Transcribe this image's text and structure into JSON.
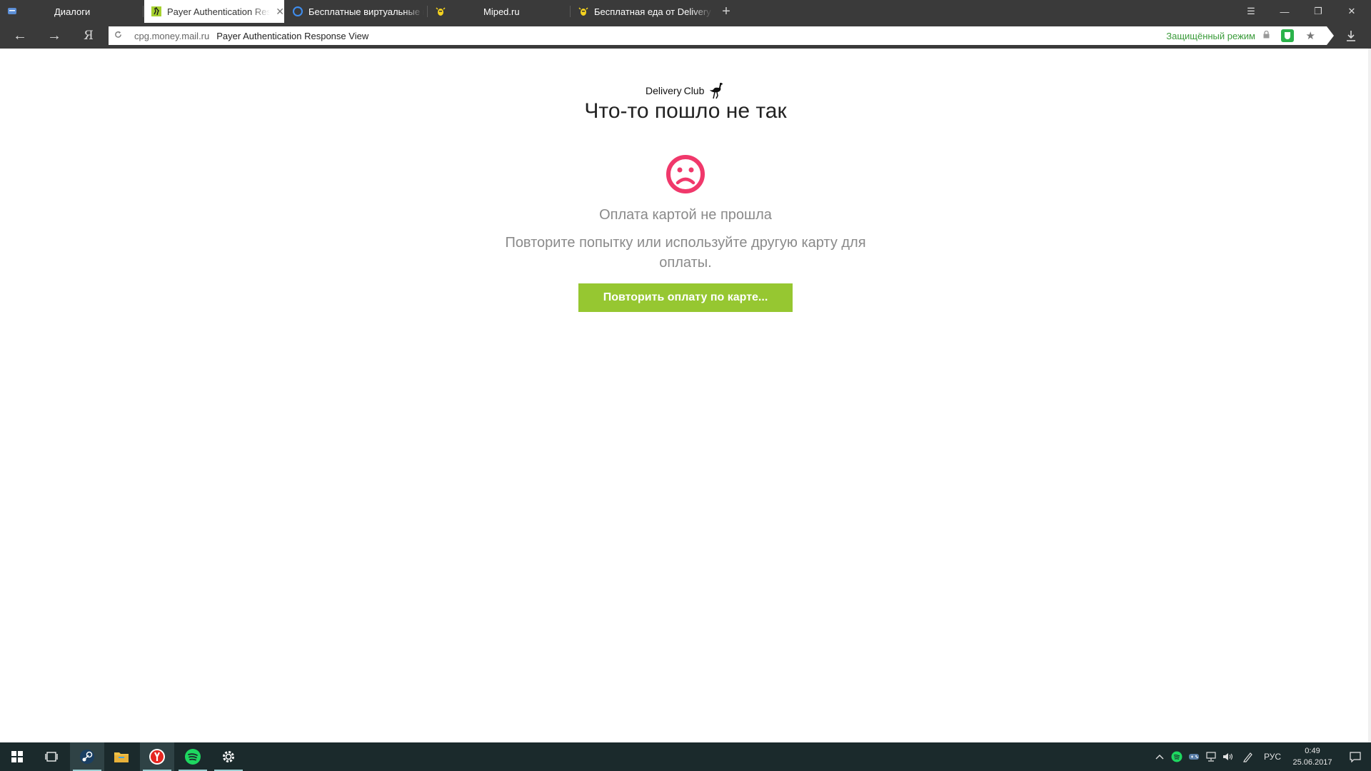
{
  "browser": {
    "tabs": [
      {
        "title": "Диалоги",
        "icon": "vk-message-icon",
        "active": false
      },
      {
        "title": "Payer Authentication Resp",
        "icon": "delivery-club-ostrich-icon",
        "active": true,
        "close": "✕"
      },
      {
        "title": "Бесплатные виртуальные н",
        "icon": "refresh-circle-icon",
        "active": false
      },
      {
        "title": "Miped.ru",
        "icon": "yellow-bug-icon",
        "active": false
      },
      {
        "title": "Бесплатная еда от Delivery",
        "icon": "yellow-bug-icon",
        "active": false
      }
    ],
    "new_tab": "+",
    "window_controls": {
      "menu": "☰",
      "minimize": "—",
      "restore": "❐",
      "close": "✕"
    },
    "nav": {
      "back": "←",
      "forward": "→",
      "yandex": "Я"
    },
    "address": {
      "domain": "cpg.money.mail.ru",
      "page_title": "Payer Authentication Response View",
      "protected_mode": "Защищённый режим"
    }
  },
  "page": {
    "brand": {
      "name_part1": "Delivery",
      "name_part2": "Club"
    },
    "headline": "Что-то пошло не так",
    "error_message": "Оплата картой не прошла",
    "hint": "Повторите попытку или используйте другую карту для оплаты.",
    "retry_button": "Повторить оплату по карте...",
    "colors": {
      "accent_green": "#96c731",
      "error_pink": "#f0386b"
    }
  },
  "taskbar": {
    "apps": [
      "windows-start-icon",
      "task-view-icon",
      "steam-icon",
      "file-explorer-icon",
      "yandex-browser-icon",
      "spotify-icon",
      "settings-gear-icon"
    ],
    "tray": [
      "chevron-up-icon",
      "spotify-tray-icon",
      "gamepad-icon",
      "network-icon",
      "volume-icon",
      "pen-icon"
    ],
    "language": "РУС",
    "time": "0:49",
    "date": "25.06.2017"
  }
}
